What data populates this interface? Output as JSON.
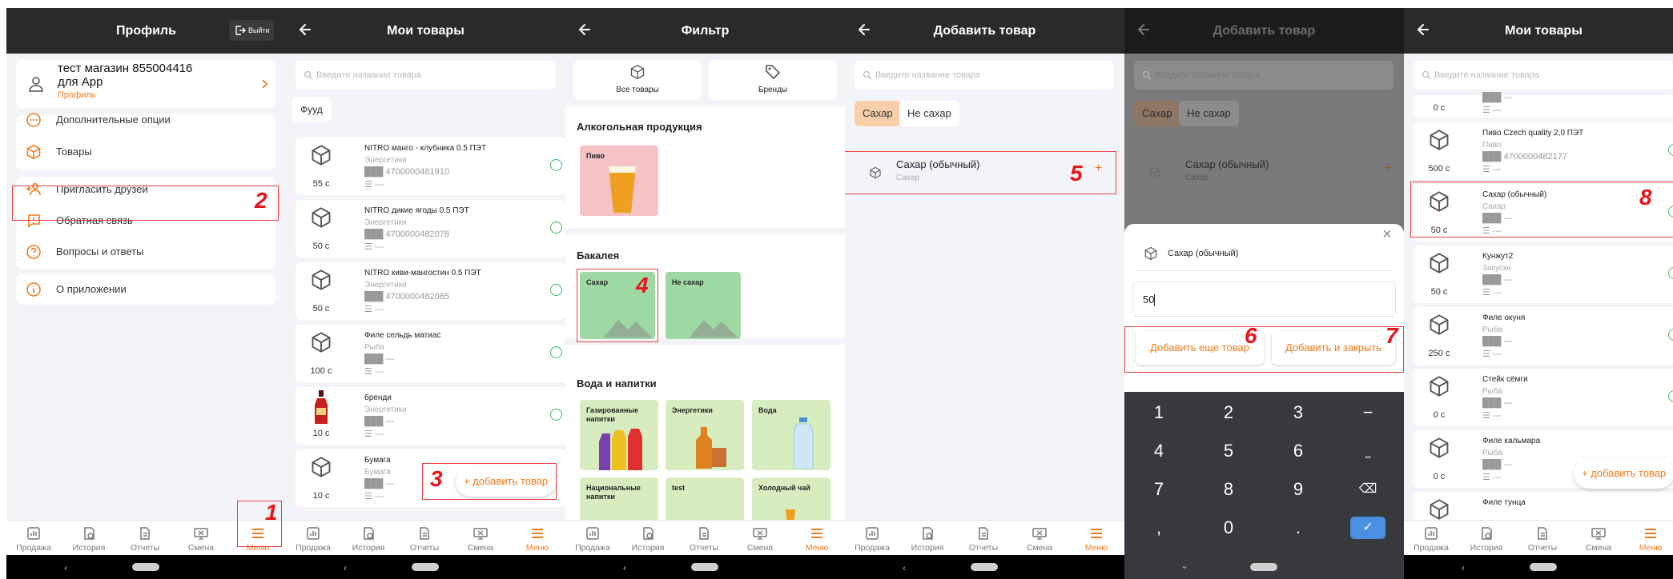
{
  "nav": {
    "items": [
      "Продажа",
      "История",
      "Отчеты",
      "Смена",
      "Меню"
    ]
  },
  "icons": {
    "back": "arrow-left-icon",
    "search": "search-icon",
    "box": "box-icon",
    "menu": "hamburger-icon"
  },
  "colors": {
    "accent": "#f27a1a",
    "topbar": "#2a2a2c",
    "annotation": "#e8141c",
    "success": "#3cba5a"
  },
  "screen1": {
    "title": "Профиль",
    "logout": "Выйти",
    "profile_name_1": "тест магазин 855004416",
    "profile_name_2": "для App",
    "profile_sub": "Профиль",
    "menu": [
      "Дополнительные опции",
      "Товары",
      "Пригласить друзей",
      "Обратная связь",
      "Вопросы и ответы",
      "О приложении"
    ]
  },
  "screen2": {
    "title": "Мои товары",
    "search_placeholder": "Введите название товара",
    "chip": "Фууд",
    "products": [
      {
        "name": "NITRO манго - клубника 0.5 ПЭТ",
        "cat": "Энергетики",
        "code": "4700000481910",
        "qty": "55 с"
      },
      {
        "name": "NITRO дикие ягоды 0.5 ПЭТ",
        "cat": "Энергетики",
        "code": "4700000482078",
        "qty": "50 с"
      },
      {
        "name": "NITRO киви-мангостин 0.5 ПЭТ",
        "cat": "Энергетики",
        "code": "4700000482085",
        "qty": "50 с"
      },
      {
        "name": "Филе сельдь матиас",
        "cat": "Рыба",
        "code": "---",
        "qty": "100 с"
      },
      {
        "name": "бренди",
        "cat": "Энергетики",
        "code": "---",
        "qty": "10 с"
      },
      {
        "name": "Бумага",
        "cat": "Бумага",
        "code": "---",
        "qty": "10 с"
      }
    ],
    "fab": "+ добавить товар",
    "dash": "---"
  },
  "screen3": {
    "title": "Фильтр",
    "all_products": "Все товары",
    "brands": "Бренды",
    "sec1": "Алкогольная продукция",
    "beer": "Пиво",
    "sec2": "Бакалея",
    "sugar": "Сахар",
    "nosugar": "Не сахар",
    "sec3": "Вода и напитки",
    "tiles": [
      "Газированные напитки",
      "Энергетики",
      "Вода",
      "Национальные напитки",
      "test",
      "Холодный чай"
    ]
  },
  "screen4": {
    "title": "Добавить товар",
    "search_placeholder": "Введите название товара",
    "chip1": "Сахар",
    "chip2": "Не сахар",
    "item_name": "Сахар (обычный)",
    "item_cat": "Сахар",
    "plus": "+"
  },
  "screen5": {
    "title": "Добавить товар",
    "dialog_title": "Сахар (обычный)",
    "input_value": "50",
    "btn_more": "Добавить еще товар",
    "btn_close": "Добавить и закрыть",
    "keys": [
      "1",
      "2",
      "3",
      "−",
      "4",
      "5",
      "6",
      "⎵",
      "7",
      "8",
      "9",
      "⌫",
      ",",
      "0",
      ".",
      "✓"
    ],
    "close": "×"
  },
  "screen6": {
    "title": "Мои товары",
    "search_placeholder": "Введите название товара",
    "products": [
      {
        "name": "",
        "cat": "",
        "code": "---",
        "qty": "0 с"
      },
      {
        "name": "Пиво Czech quality 2,0 ПЭТ",
        "cat": "Пиво",
        "code": "4700000482177",
        "qty": "500 с"
      },
      {
        "name": "Сахар (обычный)",
        "cat": "Сахар",
        "code": "---",
        "qty": "50 с"
      },
      {
        "name": "Кунжут2",
        "cat": "Закуски",
        "code": "---",
        "qty": "50 с"
      },
      {
        "name": "Филе окуня",
        "cat": "Рыба",
        "code": "---",
        "qty": "250 с"
      },
      {
        "name": "Стейк сёмги",
        "cat": "Рыба",
        "code": "---",
        "qty": "0 с"
      },
      {
        "name": "Филе кальмара",
        "cat": "Рыба",
        "code": "---",
        "qty": "0 с"
      },
      {
        "name": "Филе тунца",
        "cat": "",
        "code": "",
        "qty": ""
      }
    ],
    "fab": "+ добавить товар"
  },
  "annotations": [
    "1",
    "2",
    "3",
    "4",
    "5",
    "6",
    "7",
    "8"
  ]
}
